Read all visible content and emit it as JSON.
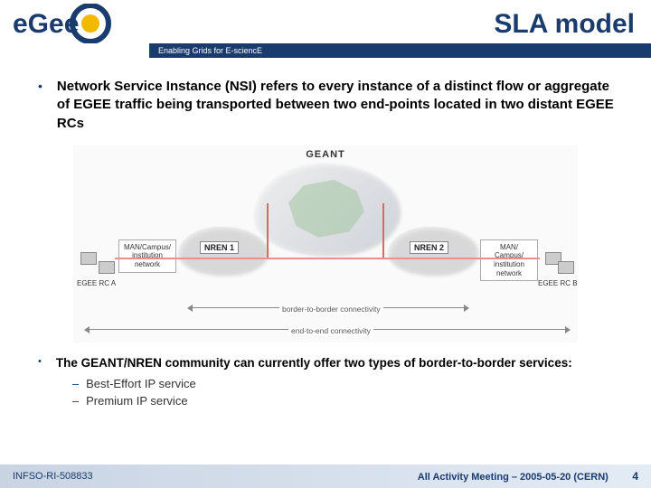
{
  "header": {
    "title": "SLA model",
    "tagline": "Enabling Grids for E-sciencE",
    "logoText": "eGee"
  },
  "bullets": [
    {
      "text": "Network Service Instance (NSI) refers to every instance of a distinct flow or aggregate of EGEE traffic being transported between two end-points located in two distant EGEE RCs"
    },
    {
      "text": "The GEANT/NREN community can currently offer two types of border-to-border services:",
      "subitems": [
        "Best-Effort IP service",
        "Premium IP service"
      ]
    }
  ],
  "diagram": {
    "geant": "GEANT",
    "nren1": "NREN 1",
    "nren2": "NREN 2",
    "manA": "MAN/Campus/\ninstitution\nnetwork",
    "manB": "MAN/ Campus/\ninstitution\nnetwork",
    "rcA": "EGEE RC A",
    "rcB": "EGEE RC B",
    "borderConn": "border-to-border connectivity",
    "endConn": "end-to-end connectivity"
  },
  "footer": {
    "left": "INFSO-RI-508833",
    "right": "All Activity Meeting – 2005-05-20 (CERN)",
    "pageNum": "4"
  }
}
